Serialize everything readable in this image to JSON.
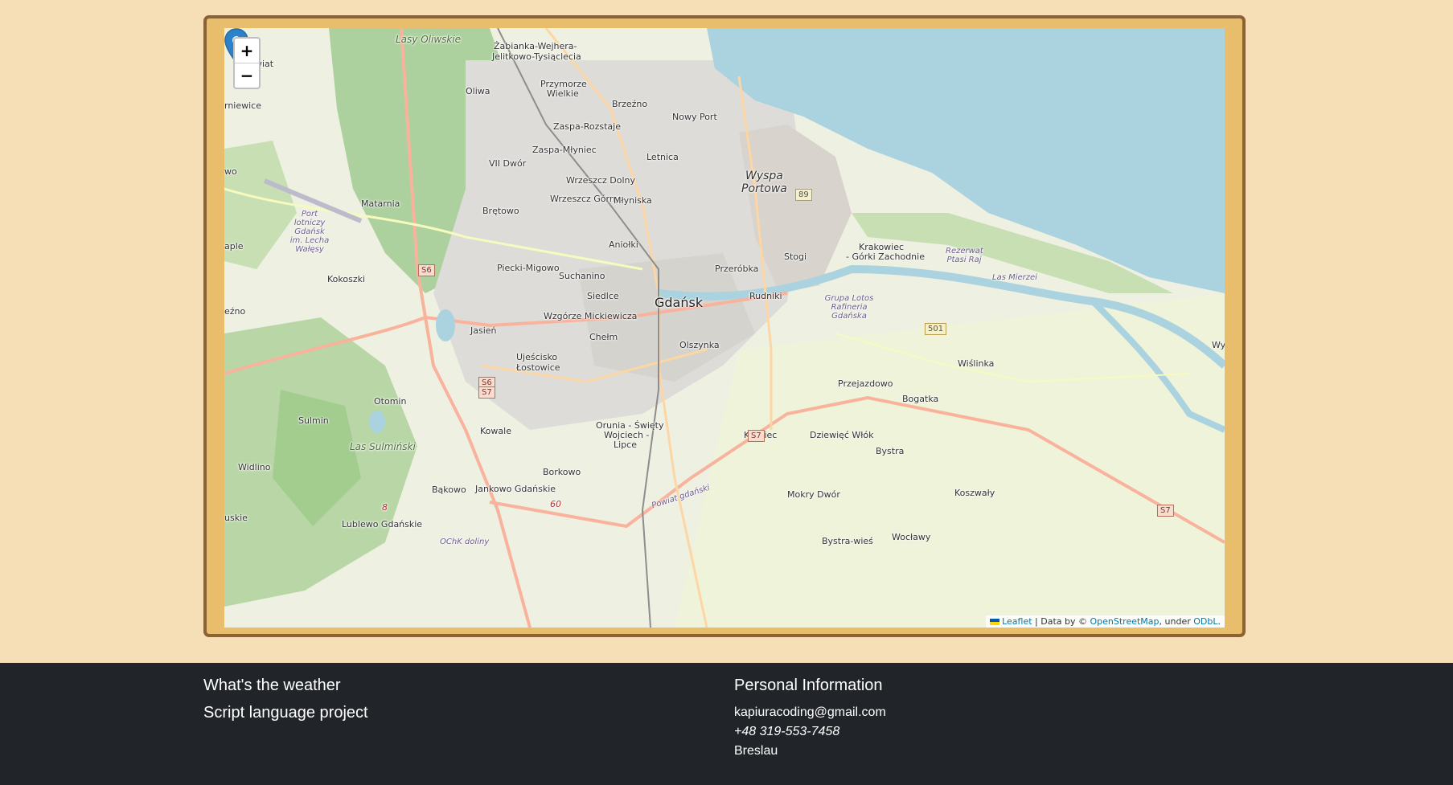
{
  "map": {
    "zoom_in": "+",
    "zoom_out": "−",
    "attribution": {
      "leaflet": "Leaflet",
      "sep": " | Data by © ",
      "osm": "OpenStreetMap",
      "under": ", under ",
      "odbl": "ODbL",
      "end": "."
    },
    "labels": {
      "gdansk": "Gdańsk",
      "wyspa": "Wyspa",
      "portowa": "Portowa",
      "lasy_oliwskie": "Lasy Oliwskie",
      "zabianka": "Żabianka-Wejhera-",
      "jelitkowo": "Jelitkowo-Tysiąclecia",
      "oliwa": "Oliwa",
      "przymorze": "Przymorze",
      "wielkie": "Wielkie",
      "brzezno": "Brzeźno",
      "nowy_port": "Nowy Port",
      "zaspa_rozstaje": "Zaspa-Rozstaje",
      "zaspa_mlyniec": "Zaspa-Młyniec",
      "letnica": "Letnica",
      "vii_dwor": "VII Dwór",
      "wrzeszcz_dolny": "Wrzeszcz Dolny",
      "wrzeszcz_gorny": "Wrzeszcz Górny",
      "mlyniska": "Młyniska",
      "matarnia": "Matarnia",
      "bretowo": "Brętowo",
      "port_lotniczy": "Port lotniczy Gdańsk im. Lecha Wałęsy",
      "aniolki": "Aniołki",
      "piecki": "Piecki-Migowo",
      "suchanino": "Suchanino",
      "przerobka": "Przeróbka",
      "stogi": "Stogi",
      "krakowiec": "Krakowiec",
      "gorki": "- Górki Zachodnie",
      "rezerwat": "Rezerwat Ptasi Raj",
      "las_mierzei": "Las Mierzei",
      "kokoszki": "Kokoszki",
      "siedlce": "Siedlce",
      "rudniki": "Rudniki",
      "grupa_lotos": "Grupa Lotos Rafineria Gdańska",
      "wzgorze": "Wzgórze Mickiewicza",
      "jasien": "Jasień",
      "chelm": "Chełm",
      "olszynka": "Olszynka",
      "wislinka": "Wiślinka",
      "ujescisko": "Ujeścisko",
      "lostowice": "Łostowice",
      "przejazdowo": "Przejazdowo",
      "bogatka": "Bogatka",
      "otomin": "Otomin",
      "sulmin": "Sulmin",
      "orunia": "Orunia - Święty",
      "wojciech": "Wojciech -",
      "lipce": "Lipce",
      "krepiec": "Krępiec",
      "dziewiec": "Dziewięć Włók",
      "kowale": "Kowale",
      "las_sulminski": "Las Sulmiński",
      "bystra": "Bystra",
      "widlino": "Widlino",
      "borkowo": "Borkowo",
      "bakowo": "Bąkowo",
      "jankowo": "Jankowo Gdańskie",
      "mokry_dwor": "Mokry Dwór",
      "koszwaly": "Koszwały",
      "powiat_gdanski": "Powiat gdański",
      "lublewo": "Lublewo Gdańskie",
      "ochk": "OChK doliny",
      "bystra_wies": "Bystra-wieś",
      "woclawy": "Wocławy",
      "wiat": "wiat",
      "rniewice": "rniewice",
      "wo": "wo",
      "aple": "aple",
      "ezno": "eźno",
      "wys": "Wys",
      "uskie": "uskie"
    },
    "shields": [
      "89",
      "S6",
      "S6",
      "S7",
      "501",
      "S7",
      "S7",
      "8",
      "60"
    ]
  },
  "footer": {
    "left_title": "What's the weather",
    "left_subtitle": "Script language project",
    "right_title": "Personal Information",
    "email": "kapiuracoding@gmail.com",
    "phone": "+48 319-553-7458",
    "city": "Breslau"
  },
  "colors": {
    "page_bg": "#f6deb6",
    "frame_border": "#8a6236",
    "frame_fill": "#e8bd6c",
    "footer_bg": "#212529",
    "sea": "#aad3df",
    "forest": "#add19e",
    "marker": "#2b82cb"
  }
}
